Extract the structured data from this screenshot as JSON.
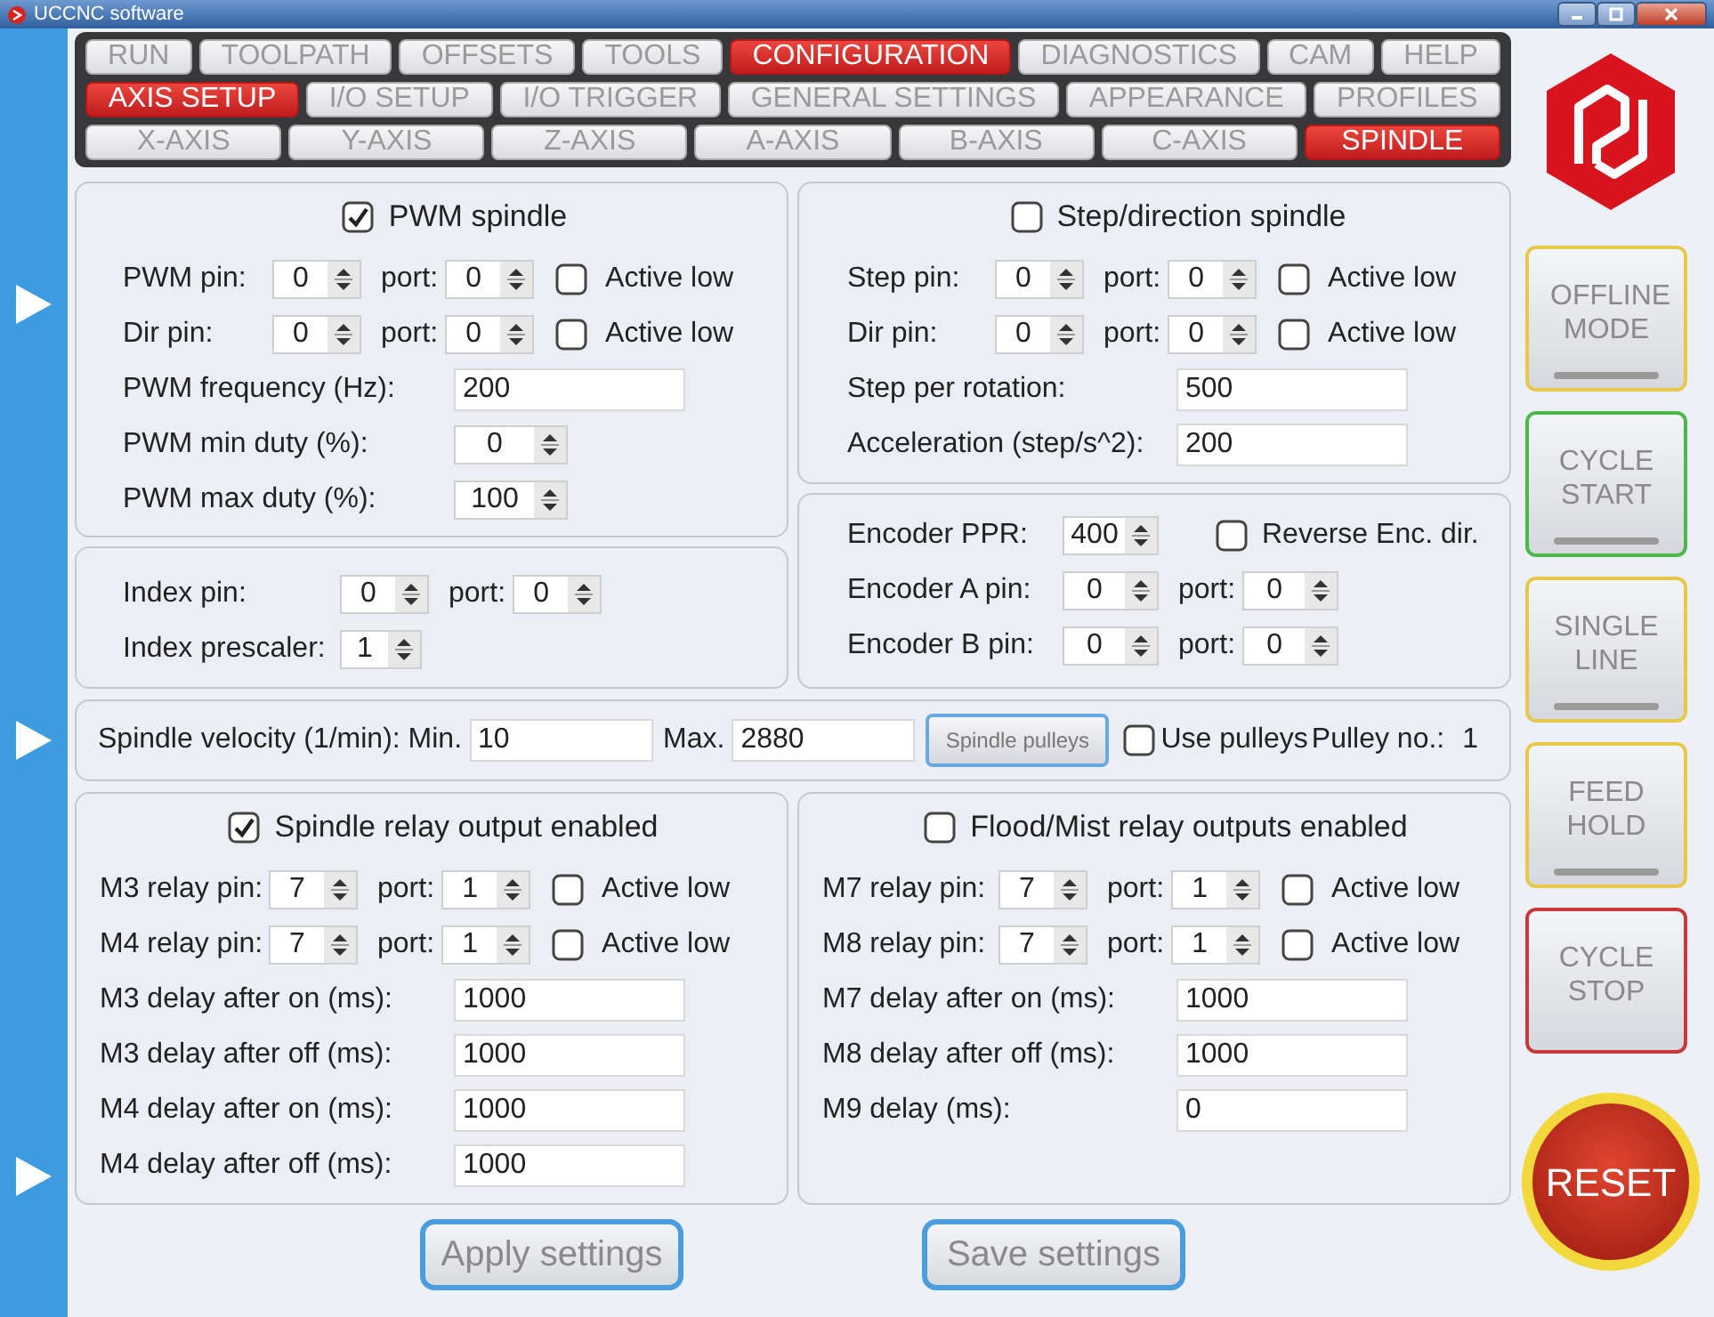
{
  "window": {
    "title": "UCCNC software"
  },
  "menu": [
    [
      {
        "label": "RUN",
        "selected": false
      },
      {
        "label": "TOOLPATH",
        "selected": false
      },
      {
        "label": "OFFSETS",
        "selected": false
      },
      {
        "label": "TOOLS",
        "selected": false
      },
      {
        "label": "CONFIGURATION",
        "selected": true
      },
      {
        "label": "DIAGNOSTICS",
        "selected": false
      },
      {
        "label": "CAM",
        "selected": false
      },
      {
        "label": "HELP",
        "selected": false
      }
    ],
    [
      {
        "label": "AXIS SETUP",
        "selected": true
      },
      {
        "label": "I/O SETUP",
        "selected": false
      },
      {
        "label": "I/O  TRIGGER",
        "selected": false
      },
      {
        "label": "GENERAL SETTINGS",
        "selected": false
      },
      {
        "label": "APPEARANCE",
        "selected": false
      },
      {
        "label": "PROFILES",
        "selected": false
      }
    ],
    [
      {
        "label": "X-AXIS",
        "selected": false
      },
      {
        "label": "Y-AXIS",
        "selected": false
      },
      {
        "label": "Z-AXIS",
        "selected": false
      },
      {
        "label": "A-AXIS",
        "selected": false
      },
      {
        "label": "B-AXIS",
        "selected": false
      },
      {
        "label": "C-AXIS",
        "selected": false
      },
      {
        "label": "SPINDLE",
        "selected": true
      }
    ]
  ],
  "top_left": [
    {
      "header": {
        "label": "PWM spindle",
        "checked": true
      },
      "rows": [
        [
          {
            "kind": "label",
            "text": "PWM pin:"
          },
          {
            "kind": "spin",
            "value": "0"
          },
          {
            "kind": "label",
            "text": "port:"
          },
          {
            "kind": "spin",
            "value": "0"
          },
          {
            "kind": "checkbox",
            "label": "Active low",
            "checked": false
          }
        ],
        [
          {
            "kind": "label",
            "text": "Dir pin:"
          },
          {
            "kind": "spin",
            "value": "0"
          },
          {
            "kind": "label",
            "text": "port:"
          },
          {
            "kind": "spin",
            "value": "0"
          },
          {
            "kind": "checkbox",
            "label": "Active low",
            "checked": false
          }
        ],
        [
          {
            "kind": "label",
            "text": "PWM frequency (Hz):"
          },
          {
            "kind": "field",
            "value": "200"
          }
        ],
        [
          {
            "kind": "label",
            "text": "PWM min duty (%):"
          },
          {
            "kind": "spin",
            "value": "0"
          }
        ],
        [
          {
            "kind": "label",
            "text": "PWM max duty (%):"
          },
          {
            "kind": "spin",
            "value": "100"
          }
        ]
      ]
    },
    {
      "rows": [
        [
          {
            "kind": "label",
            "text": "Index pin:"
          },
          {
            "kind": "spin",
            "value": "0"
          },
          {
            "kind": "label",
            "text": "port:"
          },
          {
            "kind": "spin",
            "value": "0"
          }
        ],
        [
          {
            "kind": "label",
            "text": "Index prescaler:"
          },
          {
            "kind": "spin",
            "value": "1"
          }
        ]
      ]
    }
  ],
  "top_right": [
    {
      "header": {
        "label": "Step/direction spindle",
        "checked": false
      },
      "rows": [
        [
          {
            "kind": "label",
            "text": "Step pin:"
          },
          {
            "kind": "spin",
            "value": "0"
          },
          {
            "kind": "label",
            "text": "port:"
          },
          {
            "kind": "spin",
            "value": "0"
          },
          {
            "kind": "checkbox",
            "label": "Active low",
            "checked": false
          }
        ],
        [
          {
            "kind": "label",
            "text": "Dir pin:"
          },
          {
            "kind": "spin",
            "value": "0"
          },
          {
            "kind": "label",
            "text": "port:"
          },
          {
            "kind": "spin",
            "value": "0"
          },
          {
            "kind": "checkbox",
            "label": "Active low",
            "checked": false
          }
        ],
        [
          {
            "kind": "label",
            "text": "Step per rotation:"
          },
          {
            "kind": "field",
            "value": "500"
          }
        ],
        [
          {
            "kind": "label",
            "text": "Acceleration (step/s^2):"
          },
          {
            "kind": "field",
            "value": "200"
          }
        ]
      ]
    },
    {
      "rows": [
        [
          {
            "kind": "label",
            "text": "Encoder PPR:"
          },
          {
            "kind": "spin",
            "value": "400"
          },
          {
            "kind": "gap"
          },
          {
            "kind": "checkbox",
            "label": "Reverse Enc. dir.",
            "checked": false
          }
        ],
        [
          {
            "kind": "label",
            "text": "Encoder A pin:"
          },
          {
            "kind": "spin",
            "value": "0"
          },
          {
            "kind": "label",
            "text": "port:"
          },
          {
            "kind": "spin",
            "value": "0"
          }
        ],
        [
          {
            "kind": "label",
            "text": "Encoder B pin:"
          },
          {
            "kind": "spin",
            "value": "0"
          },
          {
            "kind": "label",
            "text": "port:"
          },
          {
            "kind": "spin",
            "value": "0"
          }
        ]
      ]
    }
  ],
  "velocity": {
    "rows": [
      [
        {
          "kind": "label",
          "text": "Spindle velocity (1/min): Min."
        },
        {
          "kind": "field",
          "value": "10"
        },
        {
          "kind": "label",
          "text": "Max."
        },
        {
          "kind": "field",
          "value": "2880"
        },
        {
          "kind": "button",
          "label": "Spindle pulleys"
        },
        {
          "kind": "checkbox",
          "label": "Use pulleys",
          "checked": false
        },
        {
          "kind": "label",
          "text": "Pulley no.:"
        },
        {
          "kind": "value",
          "text": "1"
        }
      ]
    ]
  },
  "relays": [
    {
      "header": {
        "label": "Spindle relay output enabled",
        "checked": true
      },
      "rows": [
        [
          {
            "kind": "label",
            "text": "M3 relay pin:"
          },
          {
            "kind": "spin",
            "value": "7"
          },
          {
            "kind": "label",
            "text": "port:"
          },
          {
            "kind": "spin",
            "value": "1"
          },
          {
            "kind": "checkbox",
            "label": "Active low",
            "checked": false
          }
        ],
        [
          {
            "kind": "label",
            "text": "M4 relay pin:"
          },
          {
            "kind": "spin",
            "value": "7"
          },
          {
            "kind": "label",
            "text": "port:"
          },
          {
            "kind": "spin",
            "value": "1"
          },
          {
            "kind": "checkbox",
            "label": "Active low",
            "checked": false
          }
        ],
        [
          {
            "kind": "label",
            "text": "M3 delay after on (ms):"
          },
          {
            "kind": "field",
            "value": "1000"
          }
        ],
        [
          {
            "kind": "label",
            "text": "M3 delay after off (ms):"
          },
          {
            "kind": "field",
            "value": "1000"
          }
        ],
        [
          {
            "kind": "label",
            "text": "M4 delay after on (ms):"
          },
          {
            "kind": "field",
            "value": "1000"
          }
        ],
        [
          {
            "kind": "label",
            "text": "M4 delay after off (ms):"
          },
          {
            "kind": "field",
            "value": "1000"
          }
        ]
      ]
    },
    {
      "header": {
        "label": "Flood/Mist relay outputs enabled",
        "checked": false
      },
      "rows": [
        [
          {
            "kind": "label",
            "text": "M7 relay pin:"
          },
          {
            "kind": "spin",
            "value": "7"
          },
          {
            "kind": "label",
            "text": "port:"
          },
          {
            "kind": "spin",
            "value": "1"
          },
          {
            "kind": "checkbox",
            "label": "Active low",
            "checked": false
          }
        ],
        [
          {
            "kind": "label",
            "text": "M8 relay pin:"
          },
          {
            "kind": "spin",
            "value": "7"
          },
          {
            "kind": "label",
            "text": "port:"
          },
          {
            "kind": "spin",
            "value": "1"
          },
          {
            "kind": "checkbox",
            "label": "Active low",
            "checked": false
          }
        ],
        [
          {
            "kind": "label",
            "text": "M7 delay after on (ms):"
          },
          {
            "kind": "field",
            "value": "1000"
          }
        ],
        [
          {
            "kind": "label",
            "text": "M8 delay after off (ms):"
          },
          {
            "kind": "field",
            "value": "1000"
          }
        ],
        [
          {
            "kind": "label",
            "text": "M9 delay (ms):"
          },
          {
            "kind": "field",
            "value": "0"
          }
        ]
      ]
    }
  ],
  "actions": [
    "Apply settings",
    "Save settings"
  ],
  "side_buttons": [
    {
      "label": "OFFLINE MODE",
      "kind": "toggle",
      "color": "#e8c84a"
    },
    {
      "label": "CYCLE START",
      "kind": "toggle",
      "color": "#4cb84a"
    },
    {
      "label": "SINGLE LINE",
      "kind": "toggle",
      "color": "#e8c84a"
    },
    {
      "label": "FEED HOLD",
      "kind": "toggle",
      "color": "#e8c84a"
    },
    {
      "label": "CYCLE STOP",
      "kind": "push",
      "color": "#c83a3a"
    }
  ],
  "reset": "RESET"
}
